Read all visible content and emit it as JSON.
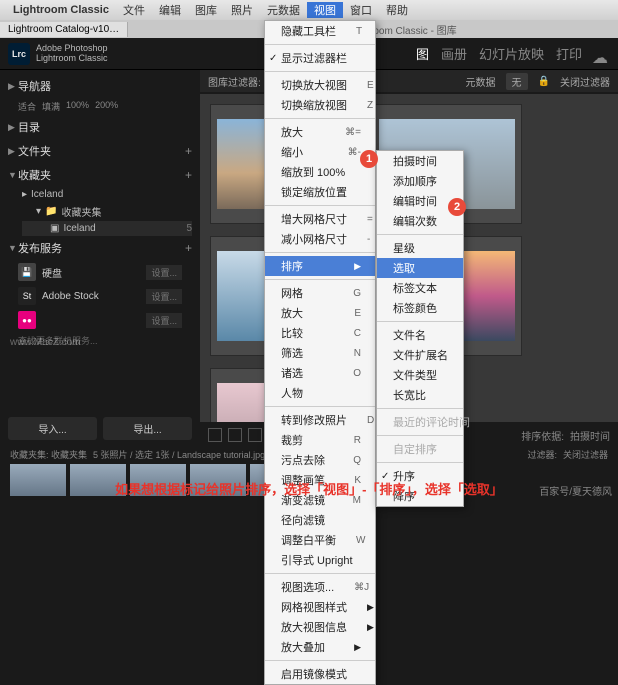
{
  "menubar": {
    "app": "Lightroom Classic",
    "items": [
      "文件",
      "编辑",
      "图库",
      "照片",
      "元数据",
      "视图",
      "窗口",
      "帮助"
    ],
    "active_index": 5
  },
  "window_title": "room Classic - 图库",
  "tab": "Lightroom Catalog-v10…",
  "brand": {
    "logo": "Lrc",
    "line1": "Adobe Photoshop",
    "line2": "Lightroom Classic"
  },
  "modules": [
    "图",
    "画册",
    "幻灯片放映",
    "打印"
  ],
  "toolbar": {
    "label": "图库过滤器:",
    "meta1": "元数据",
    "none": "无",
    "close": "关闭过滤器"
  },
  "sidebar": {
    "nav": {
      "title": "导航器",
      "zooms": [
        "适合",
        "填满",
        "100%",
        "200%"
      ]
    },
    "catalog": "目录",
    "folders": "文件夹",
    "collections": {
      "title": "收藏夹",
      "items": [
        {
          "name": "Iceland"
        },
        {
          "name": "收藏夹集",
          "indent": 1,
          "tri": "▾"
        },
        {
          "name": "Iceland",
          "indent": 2,
          "count": 5,
          "sel": true
        }
      ]
    },
    "publish": {
      "title": "发布服务",
      "hd": "硬盘",
      "as": "Adobe Stock",
      "flickr": "●●",
      "conn": "设置...",
      "find": "查找更多联机服务..."
    },
    "import": "导入...",
    "export": "导出..."
  },
  "watermark": "www.MacZ.com",
  "menu1": [
    {
      "t": "隐藏工具栏",
      "sc": "T"
    },
    "sep",
    {
      "t": "显示过滤器栏",
      "chk": true
    },
    "sep",
    {
      "t": "切换放大视图",
      "sc": "E"
    },
    {
      "t": "切换缩放视图",
      "sc": "Z"
    },
    "sep",
    {
      "t": "放大",
      "sc": "⌘="
    },
    {
      "t": "缩小",
      "sc": "⌘-"
    },
    {
      "t": "缩放到 100%"
    },
    {
      "t": "锁定缩放位置"
    },
    "sep",
    {
      "t": "增大网格尺寸",
      "sc": "="
    },
    {
      "t": "减小网格尺寸",
      "sc": "-"
    },
    "sep",
    {
      "t": "排序",
      "hl": true,
      "arr": "▶"
    },
    "sep",
    {
      "t": "网格",
      "sc": "G"
    },
    {
      "t": "放大",
      "sc": "E"
    },
    {
      "t": "比较",
      "sc": "C"
    },
    {
      "t": "筛选",
      "sc": "N"
    },
    {
      "t": "诸选",
      "sc": "O"
    },
    {
      "t": "人物"
    },
    "sep",
    {
      "t": "转到修改照片",
      "sc": "D"
    },
    {
      "t": "裁剪",
      "sc": "R"
    },
    {
      "t": "污点去除",
      "sc": "Q"
    },
    {
      "t": "调整画笔",
      "sc": "K"
    },
    {
      "t": "渐变滤镜",
      "sc": "M"
    },
    {
      "t": "径向滤镜"
    },
    {
      "t": "调整白平衡",
      "sc": "W"
    },
    {
      "t": "引导式 Upright"
    },
    "sep",
    {
      "t": "视图选项...",
      "sc": "⌘J"
    },
    {
      "t": "网格视图样式",
      "arr": "▶"
    },
    {
      "t": "放大视图信息",
      "arr": "▶"
    },
    {
      "t": "放大叠加",
      "arr": "▶"
    },
    "sep",
    {
      "t": "启用镜像模式"
    }
  ],
  "menu2": [
    {
      "t": "拍摄时间"
    },
    {
      "t": "添加顺序"
    },
    {
      "t": "编辑时间"
    },
    {
      "t": "编辑次数"
    },
    "sep",
    {
      "t": "星级"
    },
    {
      "t": "选取",
      "hl": true
    },
    {
      "t": "标签文本"
    },
    {
      "t": "标签颜色"
    },
    "sep",
    {
      "t": "文件名"
    },
    {
      "t": "文件扩展名"
    },
    {
      "t": "文件类型"
    },
    {
      "t": "长宽比"
    },
    "sep",
    {
      "t": "最近的评论时间",
      "dis": true
    },
    "sep",
    {
      "t": "自定排序",
      "dis": true
    },
    "sep",
    {
      "t": "升序",
      "chk": true
    },
    {
      "t": "降序"
    }
  ],
  "filmstrip_hdr": {
    "bc": "收藏夹集: 收藏夹集",
    "info": "5 张照片 / 选定 1张 / Landscape tutorial.jpg ▾",
    "sort_label": "排序依据:",
    "sort_value": "拍摄时间",
    "filter": "过滤器:",
    "close": "关闭过滤器"
  },
  "badges": {
    "1": "1",
    "2": "2"
  },
  "caption": "如果想根据标记给照片排序，选择「视图」-「排序」，选择「选取」",
  "attrib": "百家号/夏天德风"
}
